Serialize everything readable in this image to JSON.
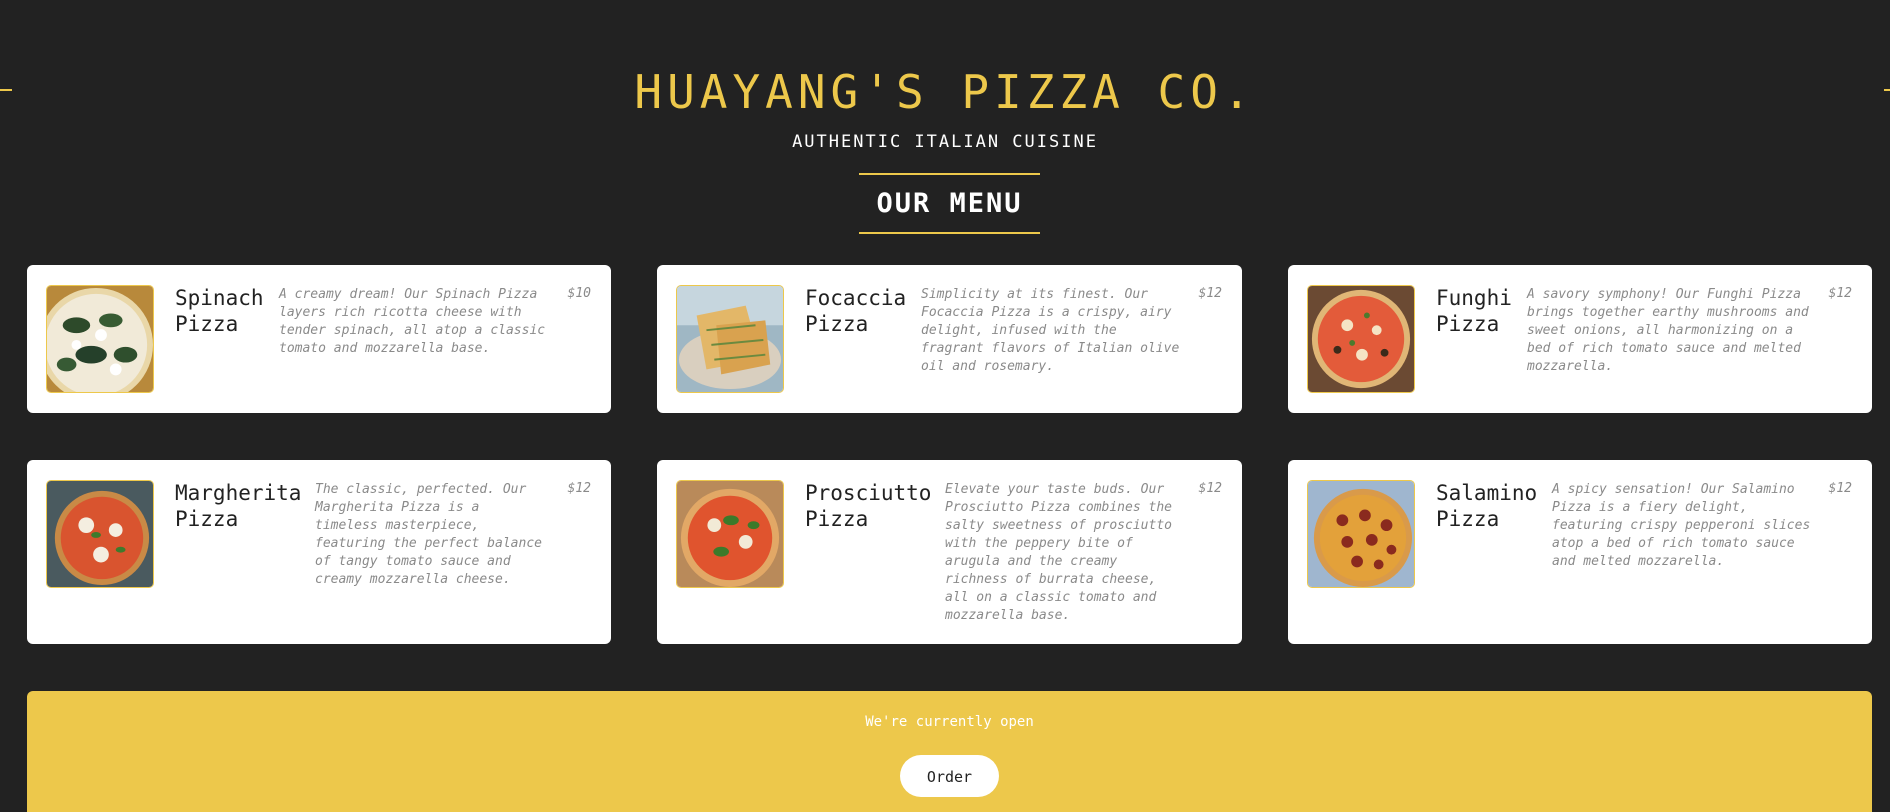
{
  "header": {
    "title": "HUAYANG'S PIZZA CO.",
    "subtitle": "AUTHENTIC ITALIAN CUISINE",
    "menu_heading": "OUR MENU"
  },
  "menu": [
    {
      "name": "Spinach\nPizza",
      "description": "A creamy dream! Our Spinach Pizza layers rich ricotta cheese with tender spinach, all atop a classic tomato and mozzarella base.",
      "price": "$10",
      "image_icon": "spinach-pizza-photo"
    },
    {
      "name": "Focaccia\nPizza",
      "description": "Simplicity at its finest. Our Focaccia Pizza is a crispy, airy delight, infused with the fragrant flavors of Italian olive oil and rosemary.",
      "price": "$12",
      "image_icon": "focaccia-pizza-photo"
    },
    {
      "name": "Funghi\nPizza",
      "description": "A savory symphony! Our Funghi Pizza brings together earthy mushrooms and sweet onions, all harmonizing on a bed of rich tomato sauce and melted mozzarella.",
      "price": "$12",
      "image_icon": "funghi-pizza-photo"
    },
    {
      "name": "Margherita\nPizza",
      "description": "The classic, perfected. Our Margherita Pizza is a timeless masterpiece, featuring the perfect balance of tangy tomato sauce and creamy mozzarella cheese.",
      "price": "$12",
      "image_icon": "margherita-pizza-photo"
    },
    {
      "name": "Prosciutto\nPizza",
      "description": "Elevate your taste buds. Our Prosciutto Pizza combines the salty sweetness of prosciutto with the peppery bite of arugula and the creamy richness of burrata cheese, all on a classic tomato and mozzarella base.",
      "price": "$12",
      "image_icon": "prosciutto-pizza-photo"
    },
    {
      "name": "Salamino\nPizza",
      "description": "A spicy sensation! Our Salamino Pizza is a fiery delight, featuring crispy pepperoni slices atop a bed of rich tomato sauce and melted mozzarella.",
      "price": "$12",
      "image_icon": "salamino-pizza-photo"
    }
  ],
  "footer": {
    "status": "We're currently open",
    "order_label": "Order"
  },
  "colors": {
    "background": "#222222",
    "accent": "#edc84b",
    "card": "#ffffff"
  }
}
